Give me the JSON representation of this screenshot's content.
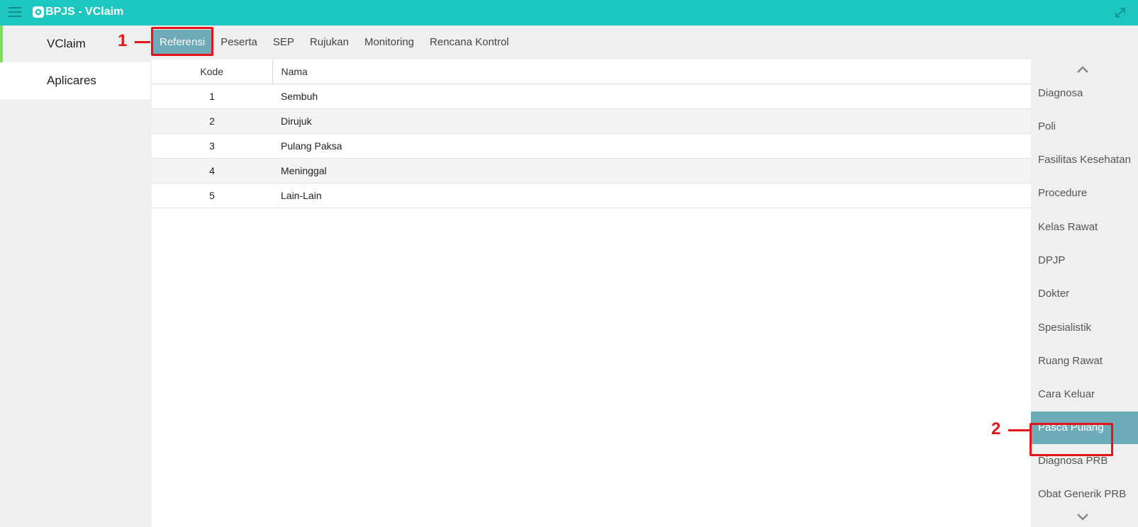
{
  "app": {
    "title": "BPJS - VClaim"
  },
  "leftnav": {
    "items": [
      {
        "label": "VClaim"
      },
      {
        "label": "Aplicares"
      }
    ]
  },
  "tabs": [
    {
      "label": "Referensi"
    },
    {
      "label": "Peserta"
    },
    {
      "label": "SEP"
    },
    {
      "label": "Rujukan"
    },
    {
      "label": "Monitoring"
    },
    {
      "label": "Rencana Kontrol"
    }
  ],
  "table": {
    "headers": {
      "kode": "Kode",
      "nama": "Nama"
    },
    "rows": [
      {
        "kode": "1",
        "nama": "Sembuh"
      },
      {
        "kode": "2",
        "nama": "Dirujuk"
      },
      {
        "kode": "3",
        "nama": "Pulang Paksa"
      },
      {
        "kode": "4",
        "nama": "Meninggal"
      },
      {
        "kode": "5",
        "nama": "Lain-Lain"
      }
    ]
  },
  "reference_menu": {
    "items": [
      "Diagnosa",
      "Poli",
      "Fasilitas Kesehatan",
      "Procedure",
      "Kelas Rawat",
      "DPJP",
      "Dokter",
      "Spesialistik",
      "Ruang Rawat",
      "Cara Keluar",
      "Pasca Pulang",
      "Diagnosa PRB",
      "Obat Generik PRB"
    ]
  },
  "annotations": {
    "step1": "1",
    "step2": "2"
  },
  "colors": {
    "titlebar": "#1dc6bf",
    "active": "#6faab8",
    "highlight": "#e3151a",
    "active_nav_border": "#7dde5c"
  }
}
